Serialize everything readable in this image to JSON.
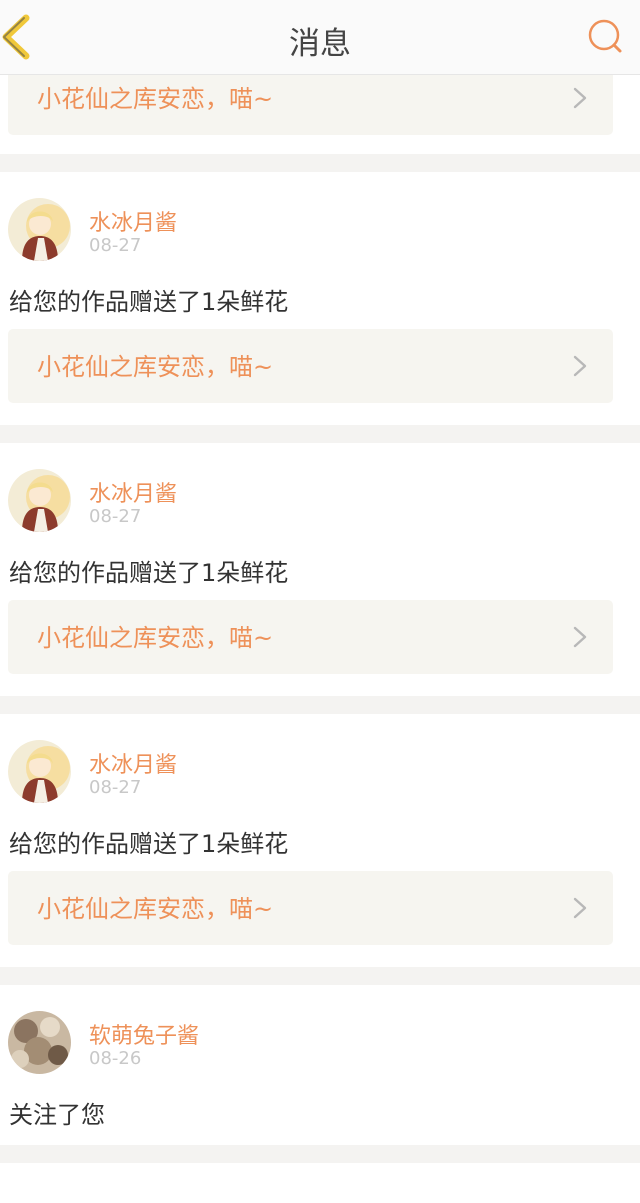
{
  "header": {
    "title": "消息",
    "back_icon": "chevron-left-icon",
    "search_icon": "search-icon",
    "accent_color": "#ee9159"
  },
  "first_partial": {
    "work_title": "小花仙之库安恋，喵~"
  },
  "messages": [
    {
      "user": "水冰月酱",
      "date": "08-27",
      "text": "给您的作品赠送了1朵鲜花",
      "work_title": "小花仙之库安恋，喵~"
    },
    {
      "user": "水冰月酱",
      "date": "08-27",
      "text": "给您的作品赠送了1朵鲜花",
      "work_title": "小花仙之库安恋，喵~"
    },
    {
      "user": "水冰月酱",
      "date": "08-27",
      "text": "给您的作品赠送了1朵鲜花",
      "work_title": "小花仙之库安恋，喵~"
    },
    {
      "user": "软萌兔子酱",
      "date": "08-26",
      "text": "关注了您"
    }
  ]
}
